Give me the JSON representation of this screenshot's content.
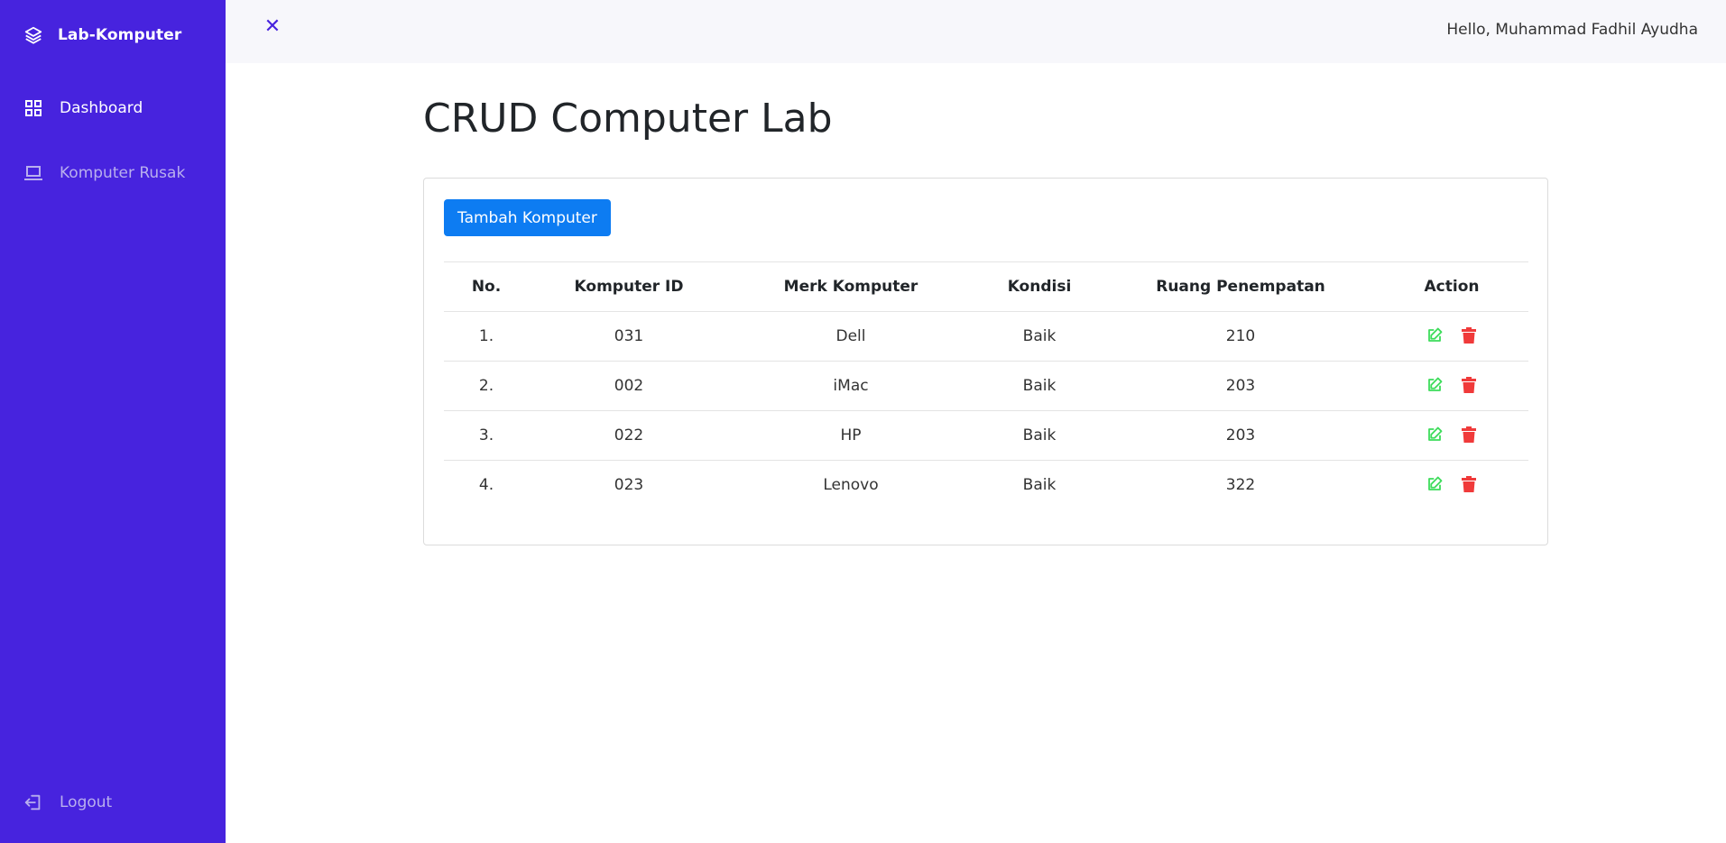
{
  "sidebar": {
    "brand": {
      "label": "Lab-Komputer",
      "icon": "layers-icon"
    },
    "items": [
      {
        "label": "Dashboard",
        "icon": "grid-icon",
        "active": true
      },
      {
        "label": "Komputer Rusak",
        "icon": "laptop-icon",
        "active": false
      }
    ],
    "logout": {
      "label": "Logout",
      "icon": "logout-icon"
    }
  },
  "topbar": {
    "close_icon": "close-icon",
    "greeting": "Hello, Muhammad Fadhil Ayudha"
  },
  "page": {
    "title": "CRUD Computer Lab",
    "add_button": "Tambah Komputer"
  },
  "table": {
    "headers": [
      "No.",
      "Komputer ID",
      "Merk Komputer",
      "Kondisi",
      "Ruang Penempatan",
      "Action"
    ],
    "rows": [
      {
        "no": "1.",
        "id": "031",
        "merk": "Dell",
        "kondisi": "Baik",
        "ruang": "210"
      },
      {
        "no": "2.",
        "id": "002",
        "merk": "iMac",
        "kondisi": "Baik",
        "ruang": "203"
      },
      {
        "no": "3.",
        "id": "022",
        "merk": "HP",
        "kondisi": "Baik",
        "ruang": "203"
      },
      {
        "no": "4.",
        "id": "023",
        "merk": "Lenovo",
        "kondisi": "Baik",
        "ruang": "322"
      }
    ]
  },
  "colors": {
    "sidebar": "#4723de",
    "primary_button": "#0d7cf2",
    "edit": "#3ddc5b",
    "delete": "#f03a3a"
  }
}
